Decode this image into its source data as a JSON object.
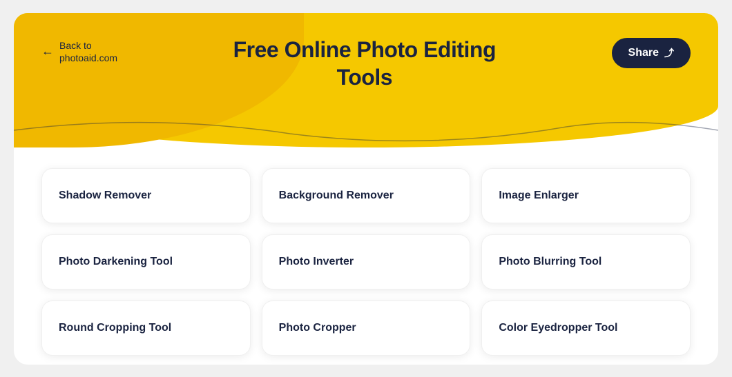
{
  "header": {
    "back_label": "Back to\nphotoaid.com",
    "title_line1": "Free Online Photo Editing",
    "title_line2": "Tools",
    "share_label": "Share"
  },
  "tools": [
    {
      "id": "shadow-remover",
      "label": "Shadow Remover"
    },
    {
      "id": "background-remover",
      "label": "Background Remover"
    },
    {
      "id": "image-enlarger",
      "label": "Image Enlarger"
    },
    {
      "id": "photo-darkening-tool",
      "label": "Photo Darkening Tool"
    },
    {
      "id": "photo-inverter",
      "label": "Photo Inverter"
    },
    {
      "id": "photo-blurring-tool",
      "label": "Photo Blurring Tool"
    },
    {
      "id": "round-cropping-tool",
      "label": "Round Cropping Tool"
    },
    {
      "id": "photo-cropper",
      "label": "Photo Cropper"
    },
    {
      "id": "color-eyedropper-tool",
      "label": "Color Eyedropper Tool"
    }
  ]
}
